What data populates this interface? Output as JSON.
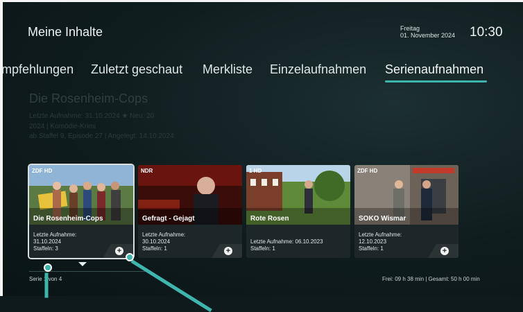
{
  "header": {
    "title": "Meine Inhalte",
    "day": "Freitag",
    "date": "01. November 2024",
    "time": "10:30"
  },
  "tabs": [
    {
      "label": "mpfehlungen",
      "active": false
    },
    {
      "label": "Zuletzt geschaut",
      "active": false
    },
    {
      "label": "Merkliste",
      "active": false
    },
    {
      "label": "Einzelaufnahmen",
      "active": false
    },
    {
      "label": "Serienaufnahmen",
      "active": true
    }
  ],
  "detail": {
    "title": "Die Rosenheim-Cops",
    "line1": "Letzte Aufnahme: 31.10.2024 ★ Neu: 20",
    "line2": "2024  |  Komödie-Krimi",
    "line3": "ab Staffel 9, Episode 27  |  Angelegt: 14.10.2024"
  },
  "tiles": [
    {
      "channel": "ZDF HD",
      "name": "Die Rosenheim-Cops",
      "line1": "Letzte Aufnahme:",
      "line2": "31.10.2024",
      "line3": "Staffeln: 3",
      "selected": true
    },
    {
      "channel": "NDR",
      "name": "Gefragt - Gejagt",
      "line1": "Letzte Aufnahme:",
      "line2": "30.10.2024",
      "line3": "Staffeln: 1",
      "selected": false
    },
    {
      "channel": "1 HD",
      "name": "Rote Rosen",
      "line1": "",
      "line2": "Letzte Aufnahme: 06.10.2023",
      "line3": "Staffeln: 1",
      "selected": false
    },
    {
      "channel": "ZDF HD",
      "name": "SOKO Wismar",
      "line1": "Letzte Aufnahme:",
      "line2": "12.10.2023",
      "line3": "Staffeln: 1",
      "selected": false
    }
  ],
  "add_symbol": "+",
  "status": {
    "left": "Serie 1 von 4",
    "right": "Frei: 09 h 38 min  |  Gesamt: 50 h 00 min"
  },
  "colors": {
    "accent": "#3fb6ad",
    "background": "#0e1a1c",
    "tile_info": "#1d2628"
  }
}
